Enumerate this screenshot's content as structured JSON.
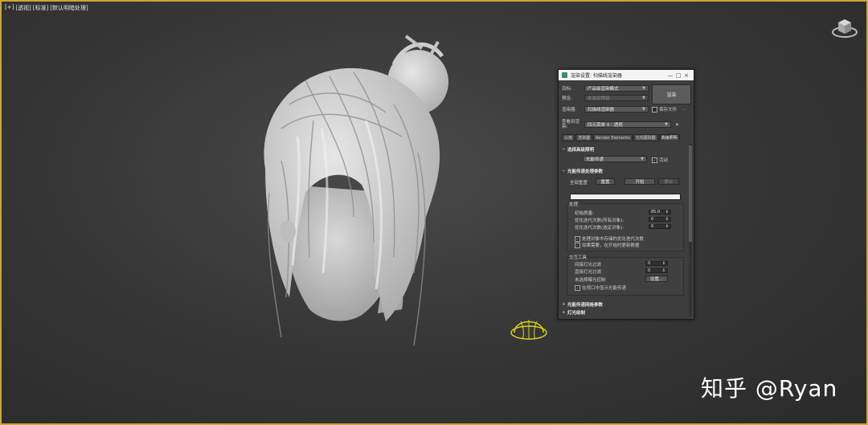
{
  "viewport": {
    "labels": [
      "[+]",
      "[透视]",
      "[标准]",
      "[默认明暗处理]"
    ]
  },
  "watermark": "知乎 @Ryan",
  "dialog": {
    "title": "渲染设置: 扫描线渲染器",
    "minimize": "—",
    "maximize": "□",
    "close": "×",
    "rows": {
      "target_label": "目标:",
      "target_value": "产品级渲染模式",
      "preset_label": "预设:",
      "preset_value": "未选定预设",
      "renderer_label": "渲染器:",
      "renderer_value": "扫描线渲染器",
      "save_file_label": "保存文件",
      "view_label": "查看到渲染:",
      "view_value": "四元菜单 4 - 透视"
    },
    "render_button": "渲染",
    "tabs": [
      "公用",
      "渲染器",
      "Render Elements",
      "光线跟踪器",
      "高级照明"
    ],
    "rollout1": {
      "title": "选择高级照明",
      "dropdown": "光能传递",
      "active_label": "活动"
    },
    "rollout2": {
      "title": "光能传递处理参数",
      "reset_all": "全部重置",
      "reset": "重置",
      "start": "开始",
      "stop": "停止",
      "process_label": "处理",
      "initial_quality": "初始质量:",
      "initial_quality_value": "85.0",
      "refine_all": "优化迭代次数(所有对象):",
      "refine_all_value": "0",
      "refine_selected": "优化迭代次数(选定对象):",
      "refine_selected_value": "0",
      "check1": "处理对象中存储的优化迭代次数",
      "check2": "如果需要，在开始时更新数据",
      "interactive_label": "交互工具",
      "indirect_filter": "间接灯光过滤",
      "indirect_filter_value": "0",
      "direct_filter": "直接灯光过滤",
      "direct_filter_value": "0",
      "exposure": "未选择曝光控制",
      "setup": "设置...",
      "check3": "在视口中显示光能传递"
    },
    "rollout3": {
      "title": "光能传递网格参数"
    },
    "rollout4": {
      "title": "灯光绘制"
    }
  }
}
